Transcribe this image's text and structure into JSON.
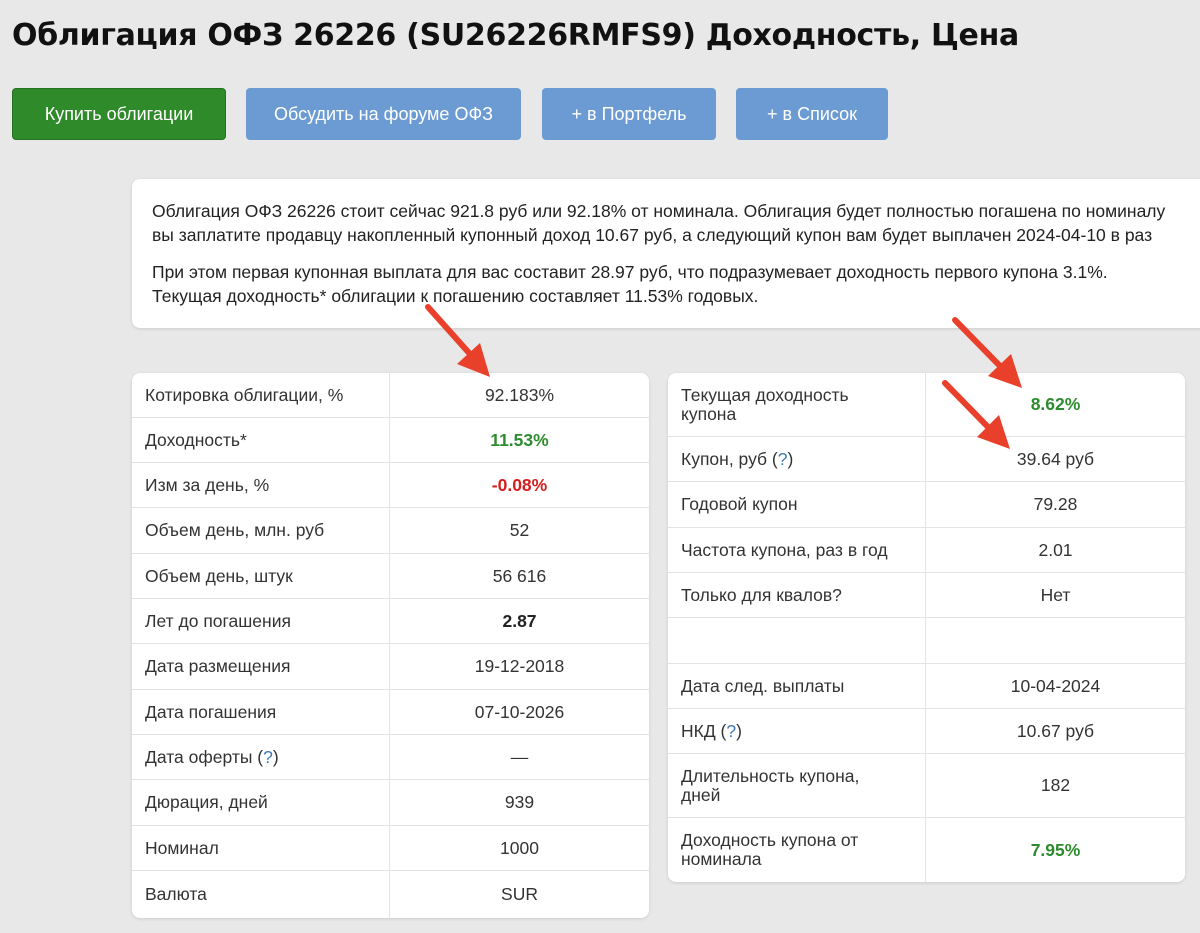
{
  "title": "Облигация ОФЗ 26226 (SU26226RMFS9) Доходность, Цена",
  "buttons": {
    "buy": "Купить облигации",
    "forum": "Обсудить на форуме ОФЗ",
    "portfolio": "+ в Портфель",
    "list": "+ в Список"
  },
  "description": {
    "p1_line1": "Облигация ОФЗ 26226 стоит сейчас 921.8 руб или 92.18% от номинала. Облигация будет полностью погашена по номиналу",
    "p1_line2": "вы заплатите продавцу накопленный купонный доход 10.67 руб, а следующий купон вам будет выплачен 2024-04-10 в раз",
    "p2_line1": "При этом первая купонная выплата для вас составит 28.97 руб, что подразумевает доходность первого купона 3.1%.",
    "p2_line2": "Текущая доходность* облигации к погашению составляет 11.53% годовых."
  },
  "help_mark": "?",
  "left_table": [
    {
      "label": "Котировка облигации, %",
      "value": "92.183%"
    },
    {
      "label": "Доходность*",
      "value": "11.53%"
    },
    {
      "label": "Изм за день, %",
      "value": "-0.08%"
    },
    {
      "label": "Объем день, млн. руб",
      "value": "52"
    },
    {
      "label": "Объем день, штук",
      "value": "56 616"
    },
    {
      "label": "Лет до погашения",
      "value": "2.87"
    },
    {
      "label": "Дата размещения",
      "value": "19-12-2018"
    },
    {
      "label": "Дата погашения",
      "value": "07-10-2026"
    },
    {
      "label": "Дата оферты",
      "value": "—"
    },
    {
      "label": "Дюрация, дней",
      "value": "939"
    },
    {
      "label": "Номинал",
      "value": "1000"
    },
    {
      "label": "Валюта",
      "value": "SUR"
    }
  ],
  "right_table": [
    {
      "label": "Текущая доходность купона",
      "value": "8.62%"
    },
    {
      "label": "Купон, руб",
      "value": "39.64 руб"
    },
    {
      "label": "Годовой купон",
      "value": "79.28"
    },
    {
      "label": "Частота купона, раз в год",
      "value": "2.01"
    },
    {
      "label": "Только для квалов?",
      "value": "Нет"
    },
    {
      "label": "",
      "value": ""
    },
    {
      "label": "Дата след. выплаты",
      "value": "10-04-2024"
    },
    {
      "label": "НКД",
      "value": "10.67 руб"
    },
    {
      "label": "Длительность купона, дней",
      "value": "182"
    },
    {
      "label": "Доходность купона от номинала",
      "value": "7.95%"
    }
  ],
  "colors": {
    "positive": "#2e8b2e",
    "negative": "#d62020",
    "buy_button": "#2f8a2a",
    "secondary_button": "#6b9bd2",
    "annotation_arrow": "#e8402a"
  }
}
